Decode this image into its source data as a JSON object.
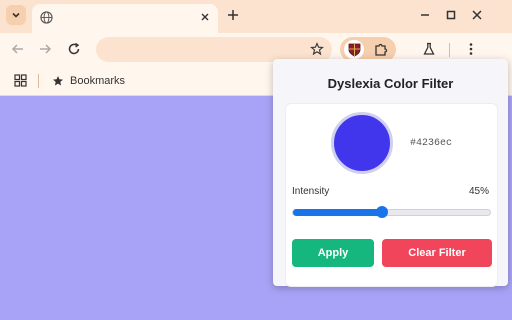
{
  "browser": {
    "tab_title": "",
    "omnibox_value": "",
    "bookmarks_label": "Bookmarks"
  },
  "popup": {
    "title": "Dyslexia Color Filter",
    "color_hex": "#4236ec",
    "intensity_label": "Intensity",
    "intensity_value": "45%",
    "intensity_fraction": 0.45,
    "apply_label": "Apply",
    "clear_label": "Clear Filter"
  },
  "colors": {
    "page_background": "#a9a3f7",
    "swatch": "#4236ec",
    "apply": "#15b77e",
    "clear": "#f0455a",
    "slider": "#1a73e8"
  },
  "icons": [
    "tab-list-icon",
    "globe-icon",
    "close-icon",
    "new-tab-icon",
    "minimize-icon",
    "maximize-icon",
    "window-close-icon",
    "back-icon",
    "forward-icon",
    "reload-icon",
    "star-icon",
    "shield-icon",
    "puzzle-icon",
    "flask-icon",
    "more-icon",
    "apps-icon",
    "bookmark-star-icon"
  ]
}
